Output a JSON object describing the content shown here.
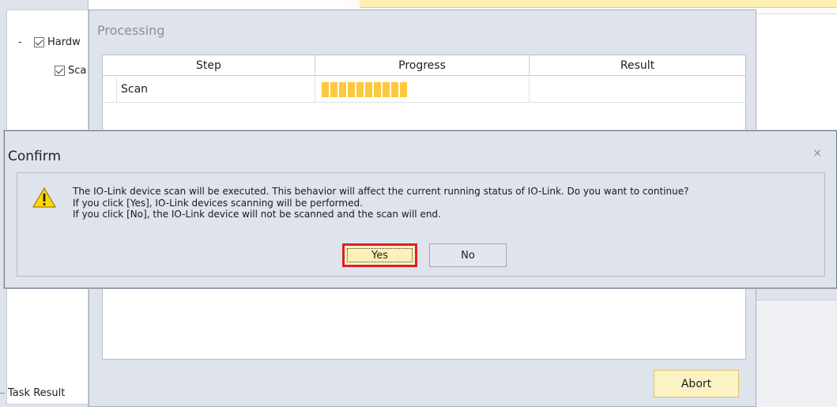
{
  "background": {
    "tree": {
      "items": [
        {
          "label": "Hardw",
          "expander": "-",
          "checked": true
        },
        {
          "label": "Sca",
          "checked": true
        }
      ]
    },
    "task_result_label": "Task Result"
  },
  "processing": {
    "title": "Processing",
    "columns": [
      "Step",
      "Progress",
      "Result"
    ],
    "rows": [
      {
        "step": "Scan",
        "progress_segments": 10,
        "result": ""
      }
    ],
    "abort_label": "Abort",
    "colors": {
      "progress": "#fcc93a",
      "abort_bg": "#fdf2c4"
    }
  },
  "confirm": {
    "title": "Confirm",
    "close_glyph": "×",
    "icon": "warning-icon",
    "message_lines": [
      "The IO-Link device scan will be executed. This behavior will affect the current running status of IO-Link. Do you want to continue?",
      "If you click [Yes], IO-Link devices scanning will be performed.",
      "If you click [No], the IO-Link device will not be scanned and the scan will end."
    ],
    "yes_label": "Yes",
    "no_label": "No",
    "colors": {
      "highlight": "#d8212b",
      "yes_bg": "#fdf0b8",
      "warning": "#ffd800"
    }
  }
}
